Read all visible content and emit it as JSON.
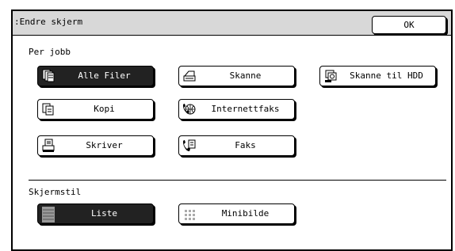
{
  "dialog": {
    "title": ":Endre skjerm",
    "ok_label": "OK"
  },
  "per_job": {
    "label": "Per jobb",
    "buttons": [
      {
        "label": "Alle Filer",
        "icon": "all-files-icon",
        "selected": true
      },
      {
        "label": "Skanne",
        "icon": "scan-icon",
        "selected": false
      },
      {
        "label": "Skanne til HDD",
        "icon": "scan-to-hdd-icon",
        "selected": false
      },
      {
        "label": "Kopi",
        "icon": "copy-icon",
        "selected": false
      },
      {
        "label": "Internettfaks",
        "icon": "internet-fax-icon",
        "selected": false
      },
      {
        "label": "Skriver",
        "icon": "printer-icon",
        "selected": false
      },
      {
        "label": "Faks",
        "icon": "fax-icon",
        "selected": false
      }
    ]
  },
  "screen_style": {
    "label": "Skjermstil",
    "buttons": [
      {
        "label": "Liste",
        "icon": "list-view-icon",
        "selected": true
      },
      {
        "label": "Minibilde",
        "icon": "thumbnail-view-icon",
        "selected": false
      }
    ]
  }
}
